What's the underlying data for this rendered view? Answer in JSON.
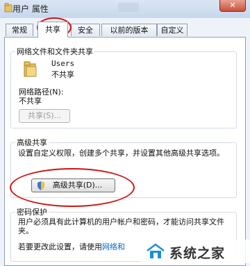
{
  "window": {
    "title": "用户 属性",
    "close_glyph": "✕"
  },
  "tabs": [
    {
      "label": "常规",
      "active": false
    },
    {
      "label": "共享",
      "active": true
    },
    {
      "label": "安全",
      "active": false
    },
    {
      "label": "以前的版本",
      "active": false
    },
    {
      "label": "自定义",
      "active": false
    }
  ],
  "network_share": {
    "legend": "网络文件和文件夹共享",
    "folder_name": "Users",
    "folder_status": "不共享",
    "path_label": "网络路径(N):",
    "path_value": "不共享",
    "share_button": "共享(S)..."
  },
  "advanced_share": {
    "legend": "高级共享",
    "description": "设置自定义权限，创建多个共享，并设置其他高级共享选项。",
    "button_label": "高级共享(D)..."
  },
  "password": {
    "legend": "密码保护",
    "description": "用户必须具有此计算机的用户帐户和密码，才能访问共享文件夹。",
    "change_text": "若要更改此设置，请使用",
    "link_text": "网络和"
  },
  "watermark": {
    "text": "系统之家"
  },
  "colors": {
    "highlight": "#d01212",
    "link": "#0066cc",
    "folder": "#e8c25a"
  }
}
